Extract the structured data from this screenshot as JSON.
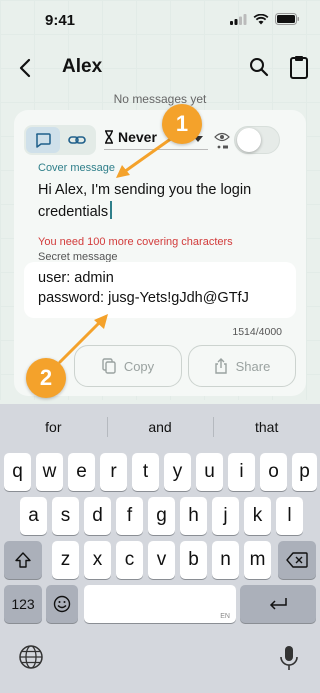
{
  "status": {
    "time": "9:41"
  },
  "nav": {
    "title": "Alex"
  },
  "chat": {
    "empty_text": "No messages yet"
  },
  "composer": {
    "timer": "Never",
    "cover_label": "Cover message",
    "cover_text": "Hi Alex, I'm sending you the login credentials",
    "warning": "You need 100 more covering characters",
    "secret_label": "Secret message",
    "secret_lines": [
      "user: admin",
      "password: jusg-Yets!gJdh@GTfJ"
    ],
    "counter": "1514/4000",
    "copy_label": "Copy",
    "share_label": "Share"
  },
  "markers": [
    "1",
    "2"
  ],
  "keyboard": {
    "suggestions": [
      "for",
      "and",
      "that"
    ],
    "row1": [
      "q",
      "w",
      "e",
      "r",
      "t",
      "y",
      "u",
      "i",
      "o",
      "p"
    ],
    "row2": [
      "a",
      "s",
      "d",
      "f",
      "g",
      "h",
      "j",
      "k",
      "l"
    ],
    "row3": [
      "z",
      "x",
      "c",
      "v",
      "b",
      "n",
      "m"
    ],
    "numbers_label": "123",
    "space_lang": "EN"
  },
  "colors": {
    "accent": "#2f7f8a",
    "warning": "#d23b3b",
    "marker": "#f4a22b"
  }
}
